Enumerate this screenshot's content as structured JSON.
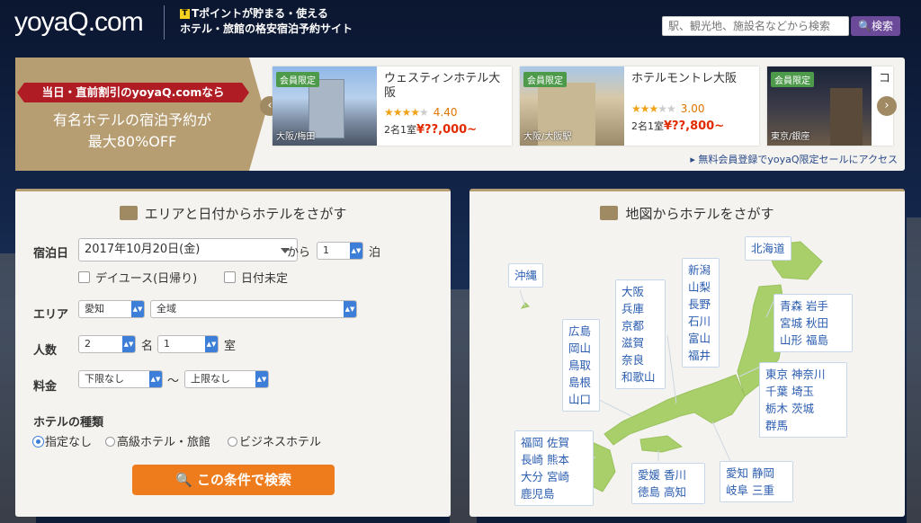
{
  "header": {
    "logo": "yoyaQ.com",
    "tagline_line1": "Tポイントが貯まる・使える",
    "tagline_line2": "ホテル・旅館の格安宿泊予約サイト",
    "search_placeholder": "駅、観光地、施設名などから検索",
    "search_button": "検索"
  },
  "banner": {
    "ribbon": "当日・直前割引のyoyaQ.comなら",
    "line1": "有名ホテルの宿泊予約が",
    "line2": "最大80%OFF",
    "member_link": "無料会員登録でyoyaQ限定セールにアクセス",
    "prev": "‹",
    "next": "›",
    "cards": [
      {
        "badge": "会員限定",
        "name": "ウェスティンホテル大阪",
        "stars": 4,
        "rating": "4.40",
        "price_prefix": "2名1室",
        "price": "¥??,000~",
        "location": "大阪/梅田"
      },
      {
        "badge": "会員限定",
        "name": "ホテルモントレ大阪",
        "stars": 3,
        "rating": "3.00",
        "price_prefix": "2名1室",
        "price": "¥??,800~",
        "location": "大阪/大阪駅"
      },
      {
        "badge": "会員限定",
        "name": "コ",
        "location": "東京/銀座"
      }
    ]
  },
  "search_panel": {
    "title": "エリアと日付からホテルをさがす",
    "stay_label": "宿泊日",
    "date_value": "2017年10月20日(金)",
    "from": "から",
    "nights": "1",
    "nights_unit": "泊",
    "dayuse": "デイユース(日帰り)",
    "date_undecided": "日付未定",
    "area_label": "エリア",
    "prefecture": "愛知",
    "city": "全域",
    "people_label": "人数",
    "people": "2",
    "people_unit": "名",
    "rooms": "1",
    "rooms_unit": "室",
    "price_label": "料金",
    "price_min": "下限なし",
    "tilde": "〜",
    "price_max": "上限なし",
    "type_label": "ホテルの種類",
    "type_options": [
      "指定なし",
      "高級ホテル・旅館",
      "ビジネスホテル"
    ],
    "submit": "この条件で検索"
  },
  "map_panel": {
    "title": "地図からホテルをさがす",
    "regions": {
      "hokkaido": [
        "北海道"
      ],
      "okinawa": [
        "沖縄"
      ],
      "tohoku": [
        "青森",
        "岩手",
        "宮城",
        "秋田",
        "山形",
        "福島"
      ],
      "kanto": [
        "東京",
        "神奈川",
        "千葉",
        "埼玉",
        "栃木",
        "茨城",
        "群馬"
      ],
      "chubu": [
        "新潟",
        "山梨",
        "長野",
        "石川",
        "富山",
        "福井"
      ],
      "kansai": [
        "大阪",
        "兵庫",
        "京都",
        "滋賀",
        "奈良",
        "和歌山"
      ],
      "chugoku": [
        "広島",
        "岡山",
        "鳥取",
        "島根",
        "山口"
      ],
      "kyushu": [
        "福岡",
        "佐賀",
        "長崎",
        "熊本",
        "大分",
        "宮崎",
        "鹿児島"
      ],
      "shikoku": [
        "愛媛",
        "香川",
        "徳島",
        "高知"
      ],
      "tokai": [
        "愛知",
        "静岡",
        "岐阜",
        "三重"
      ]
    }
  }
}
